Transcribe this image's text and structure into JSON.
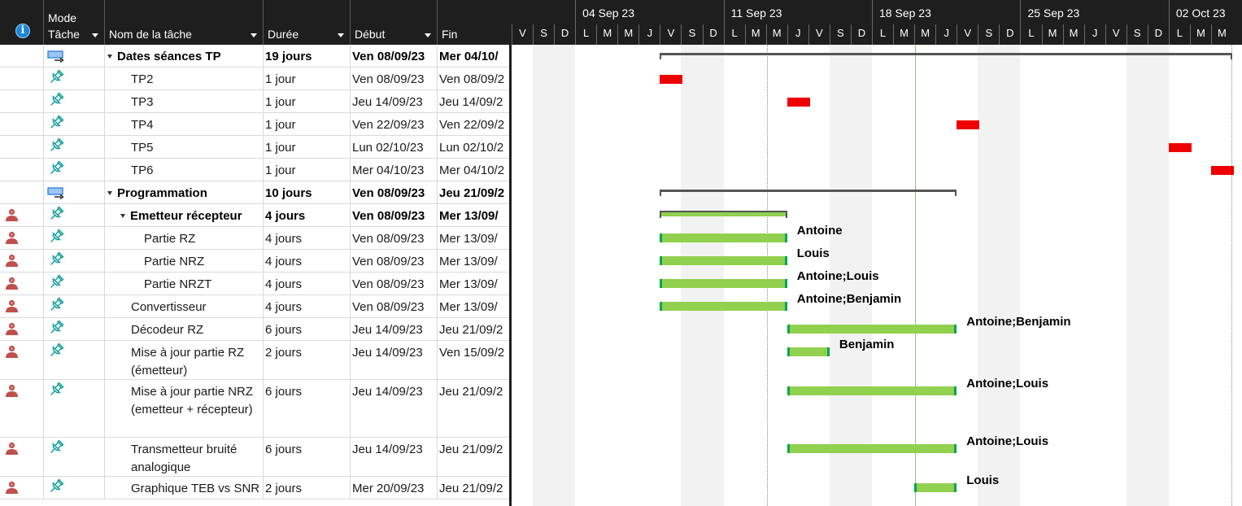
{
  "grid": {
    "columns": {
      "info": "",
      "mode": "Mode\nTâche",
      "name": "Nom de la tâche",
      "duration": "Durée",
      "start": "Début",
      "finish": "Fin"
    },
    "rows": [
      {
        "ind": "",
        "mode": "summary",
        "name": "Dates séances TP",
        "level": 0,
        "summary": true,
        "duration": "19 jours",
        "start": "Ven 08/09/23",
        "finish": "Mer 04/10/"
      },
      {
        "ind": "",
        "mode": "pin",
        "name": "TP2",
        "level": 1,
        "duration": "1 jour",
        "start": "Ven 08/09/23",
        "finish": "Ven 08/09/2"
      },
      {
        "ind": "",
        "mode": "pin",
        "name": "TP3",
        "level": 1,
        "duration": "1 jour",
        "start": "Jeu 14/09/23",
        "finish": "Jeu 14/09/2"
      },
      {
        "ind": "",
        "mode": "pin",
        "name": "TP4",
        "level": 1,
        "duration": "1 jour",
        "start": "Ven 22/09/23",
        "finish": "Ven 22/09/2"
      },
      {
        "ind": "",
        "mode": "pin",
        "name": "TP5",
        "level": 1,
        "duration": "1 jour",
        "start": "Lun 02/10/23",
        "finish": "Lun 02/10/2"
      },
      {
        "ind": "",
        "mode": "pin",
        "name": "TP6",
        "level": 1,
        "duration": "1 jour",
        "start": "Mer 04/10/23",
        "finish": "Mer 04/10/2"
      },
      {
        "ind": "",
        "mode": "summary",
        "name": "Programmation",
        "level": 0,
        "summary": true,
        "duration": "10 jours",
        "start": "Ven 08/09/23",
        "finish": "Jeu 21/09/2"
      },
      {
        "ind": "person",
        "mode": "pin",
        "name": "Emetteur récepteur",
        "level": 1,
        "summary": true,
        "duration": "4 jours",
        "start": "Ven 08/09/23",
        "finish": "Mer 13/09/"
      },
      {
        "ind": "person",
        "mode": "pin",
        "name": "Partie RZ",
        "level": 2,
        "duration": "4 jours",
        "start": "Ven 08/09/23",
        "finish": "Mer 13/09/"
      },
      {
        "ind": "person",
        "mode": "pin",
        "name": "Partie NRZ",
        "level": 2,
        "duration": "4 jours",
        "start": "Ven 08/09/23",
        "finish": "Mer 13/09/"
      },
      {
        "ind": "person",
        "mode": "pin",
        "name": "Partie NRZT",
        "level": 2,
        "duration": "4 jours",
        "start": "Ven 08/09/23",
        "finish": "Mer 13/09/"
      },
      {
        "ind": "person",
        "mode": "pin",
        "name": "Convertisseur",
        "level": 1,
        "duration": "4 jours",
        "start": "Ven 08/09/23",
        "finish": "Mer 13/09/"
      },
      {
        "ind": "person",
        "mode": "pin",
        "name": "Décodeur RZ",
        "level": 1,
        "duration": "6 jours",
        "start": "Jeu 14/09/23",
        "finish": "Jeu 21/09/2"
      },
      {
        "ind": "person",
        "mode": "pin",
        "name": "Mise à jour partie RZ (émetteur)",
        "level": 1,
        "duration": "2 jours",
        "start": "Jeu 14/09/23",
        "finish": "Ven 15/09/2"
      },
      {
        "ind": "person",
        "mode": "pin",
        "name": "Mise à jour partie NRZ (emetteur + récepteur)",
        "level": 1,
        "duration": "6 jours",
        "start": "Jeu 14/09/23",
        "finish": "Jeu 21/09/2"
      },
      {
        "ind": "person",
        "mode": "pin",
        "name": "Transmetteur bruité analogique",
        "level": 1,
        "duration": "6 jours",
        "start": "Jeu 14/09/23",
        "finish": "Jeu 21/09/2"
      },
      {
        "ind": "person",
        "mode": "pin",
        "name": "Graphique TEB vs SNR",
        "level": 1,
        "duration": "2 jours",
        "start": "Mer 20/09/23",
        "finish": "Jeu 21/09/2"
      }
    ]
  },
  "timescale": {
    "weeks": [
      "04 Sep 23",
      "11 Sep 23",
      "18 Sep 23",
      "25 Sep 23",
      "02 Oct 23"
    ],
    "days": [
      "V",
      "S",
      "D",
      "L",
      "M",
      "M",
      "J",
      "V",
      "S",
      "D",
      "L",
      "M",
      "M",
      "J",
      "V",
      "S",
      "D",
      "L",
      "M",
      "M",
      "J",
      "V",
      "S",
      "D",
      "L",
      "M",
      "M",
      "J",
      "V",
      "S",
      "D",
      "L",
      "M",
      "M"
    ]
  },
  "gantt": {
    "tasks": [
      {
        "type": "summary",
        "start": "2023-09-08",
        "finish": "2023-10-04"
      },
      {
        "type": "milestone",
        "start": "2023-09-08",
        "finish": "2023-09-08"
      },
      {
        "type": "milestone",
        "start": "2023-09-14",
        "finish": "2023-09-14"
      },
      {
        "type": "milestone",
        "start": "2023-09-22",
        "finish": "2023-09-22"
      },
      {
        "type": "milestone",
        "start": "2023-10-02",
        "finish": "2023-10-02"
      },
      {
        "type": "milestone",
        "start": "2023-10-04",
        "finish": "2023-10-04"
      },
      {
        "type": "summary",
        "start": "2023-09-08",
        "finish": "2023-09-21"
      },
      {
        "type": "green-summary",
        "start": "2023-09-08",
        "finish": "2023-09-13"
      },
      {
        "type": "task",
        "start": "2023-09-08",
        "finish": "2023-09-13",
        "resource": "Antoine"
      },
      {
        "type": "task",
        "start": "2023-09-08",
        "finish": "2023-09-13",
        "resource": "Louis"
      },
      {
        "type": "task",
        "start": "2023-09-08",
        "finish": "2023-09-13",
        "resource": "Antoine;Louis"
      },
      {
        "type": "task",
        "start": "2023-09-08",
        "finish": "2023-09-13",
        "resource": "Antoine;Benjamin"
      },
      {
        "type": "task",
        "start": "2023-09-14",
        "finish": "2023-09-21",
        "resource": "Antoine;Benjamin"
      },
      {
        "type": "task",
        "start": "2023-09-14",
        "finish": "2023-09-15",
        "resource": "Benjamin"
      },
      {
        "type": "task",
        "start": "2023-09-14",
        "finish": "2023-09-21",
        "resource": "Antoine;Louis"
      },
      {
        "type": "task",
        "start": "2023-09-14",
        "finish": "2023-09-21",
        "resource": "Antoine;Louis"
      },
      {
        "type": "task",
        "start": "2023-09-20",
        "finish": "2023-09-21",
        "resource": "Louis"
      }
    ]
  },
  "colors": {
    "milestone": "#ee0000",
    "task": "#92d050",
    "task_edge": "#00a651",
    "person_icon": "#c0504d",
    "pin_icon": "#19a0a0",
    "summary_icon": "#2e7bd6"
  }
}
